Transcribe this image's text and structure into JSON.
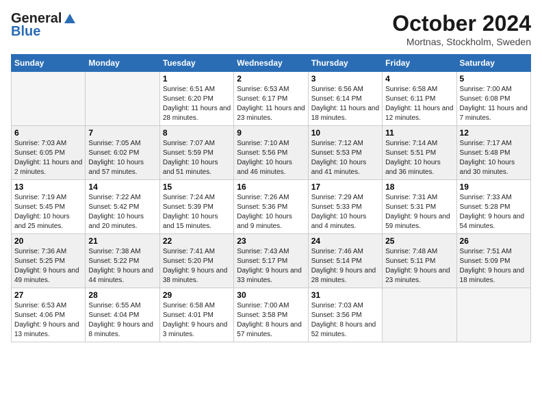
{
  "header": {
    "logo_general": "General",
    "logo_blue": "Blue",
    "month_title": "October 2024",
    "subtitle": "Mortnas, Stockholm, Sweden"
  },
  "weekdays": [
    "Sunday",
    "Monday",
    "Tuesday",
    "Wednesday",
    "Thursday",
    "Friday",
    "Saturday"
  ],
  "weeks": [
    [
      {
        "day": "",
        "info": ""
      },
      {
        "day": "",
        "info": ""
      },
      {
        "day": "1",
        "info": "Sunrise: 6:51 AM\nSunset: 6:20 PM\nDaylight: 11 hours and 28 minutes."
      },
      {
        "day": "2",
        "info": "Sunrise: 6:53 AM\nSunset: 6:17 PM\nDaylight: 11 hours and 23 minutes."
      },
      {
        "day": "3",
        "info": "Sunrise: 6:56 AM\nSunset: 6:14 PM\nDaylight: 11 hours and 18 minutes."
      },
      {
        "day": "4",
        "info": "Sunrise: 6:58 AM\nSunset: 6:11 PM\nDaylight: 11 hours and 12 minutes."
      },
      {
        "day": "5",
        "info": "Sunrise: 7:00 AM\nSunset: 6:08 PM\nDaylight: 11 hours and 7 minutes."
      }
    ],
    [
      {
        "day": "6",
        "info": "Sunrise: 7:03 AM\nSunset: 6:05 PM\nDaylight: 11 hours and 2 minutes."
      },
      {
        "day": "7",
        "info": "Sunrise: 7:05 AM\nSunset: 6:02 PM\nDaylight: 10 hours and 57 minutes."
      },
      {
        "day": "8",
        "info": "Sunrise: 7:07 AM\nSunset: 5:59 PM\nDaylight: 10 hours and 51 minutes."
      },
      {
        "day": "9",
        "info": "Sunrise: 7:10 AM\nSunset: 5:56 PM\nDaylight: 10 hours and 46 minutes."
      },
      {
        "day": "10",
        "info": "Sunrise: 7:12 AM\nSunset: 5:53 PM\nDaylight: 10 hours and 41 minutes."
      },
      {
        "day": "11",
        "info": "Sunrise: 7:14 AM\nSunset: 5:51 PM\nDaylight: 10 hours and 36 minutes."
      },
      {
        "day": "12",
        "info": "Sunrise: 7:17 AM\nSunset: 5:48 PM\nDaylight: 10 hours and 30 minutes."
      }
    ],
    [
      {
        "day": "13",
        "info": "Sunrise: 7:19 AM\nSunset: 5:45 PM\nDaylight: 10 hours and 25 minutes."
      },
      {
        "day": "14",
        "info": "Sunrise: 7:22 AM\nSunset: 5:42 PM\nDaylight: 10 hours and 20 minutes."
      },
      {
        "day": "15",
        "info": "Sunrise: 7:24 AM\nSunset: 5:39 PM\nDaylight: 10 hours and 15 minutes."
      },
      {
        "day": "16",
        "info": "Sunrise: 7:26 AM\nSunset: 5:36 PM\nDaylight: 10 hours and 9 minutes."
      },
      {
        "day": "17",
        "info": "Sunrise: 7:29 AM\nSunset: 5:33 PM\nDaylight: 10 hours and 4 minutes."
      },
      {
        "day": "18",
        "info": "Sunrise: 7:31 AM\nSunset: 5:31 PM\nDaylight: 9 hours and 59 minutes."
      },
      {
        "day": "19",
        "info": "Sunrise: 7:33 AM\nSunset: 5:28 PM\nDaylight: 9 hours and 54 minutes."
      }
    ],
    [
      {
        "day": "20",
        "info": "Sunrise: 7:36 AM\nSunset: 5:25 PM\nDaylight: 9 hours and 49 minutes."
      },
      {
        "day": "21",
        "info": "Sunrise: 7:38 AM\nSunset: 5:22 PM\nDaylight: 9 hours and 44 minutes."
      },
      {
        "day": "22",
        "info": "Sunrise: 7:41 AM\nSunset: 5:20 PM\nDaylight: 9 hours and 38 minutes."
      },
      {
        "day": "23",
        "info": "Sunrise: 7:43 AM\nSunset: 5:17 PM\nDaylight: 9 hours and 33 minutes."
      },
      {
        "day": "24",
        "info": "Sunrise: 7:46 AM\nSunset: 5:14 PM\nDaylight: 9 hours and 28 minutes."
      },
      {
        "day": "25",
        "info": "Sunrise: 7:48 AM\nSunset: 5:11 PM\nDaylight: 9 hours and 23 minutes."
      },
      {
        "day": "26",
        "info": "Sunrise: 7:51 AM\nSunset: 5:09 PM\nDaylight: 9 hours and 18 minutes."
      }
    ],
    [
      {
        "day": "27",
        "info": "Sunrise: 6:53 AM\nSunset: 4:06 PM\nDaylight: 9 hours and 13 minutes."
      },
      {
        "day": "28",
        "info": "Sunrise: 6:55 AM\nSunset: 4:04 PM\nDaylight: 9 hours and 8 minutes."
      },
      {
        "day": "29",
        "info": "Sunrise: 6:58 AM\nSunset: 4:01 PM\nDaylight: 9 hours and 3 minutes."
      },
      {
        "day": "30",
        "info": "Sunrise: 7:00 AM\nSunset: 3:58 PM\nDaylight: 8 hours and 57 minutes."
      },
      {
        "day": "31",
        "info": "Sunrise: 7:03 AM\nSunset: 3:56 PM\nDaylight: 8 hours and 52 minutes."
      },
      {
        "day": "",
        "info": ""
      },
      {
        "day": "",
        "info": ""
      }
    ]
  ]
}
